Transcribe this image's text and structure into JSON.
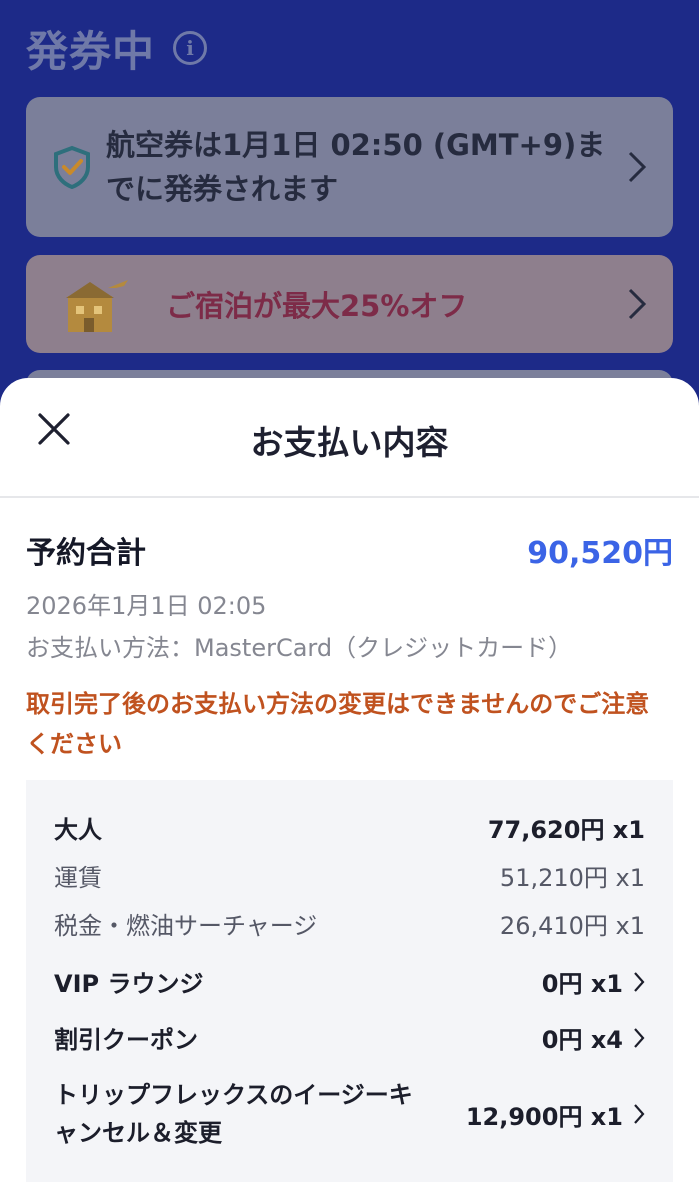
{
  "background": {
    "title": "発券中",
    "ticket_notice": "航空券は1月1日 02:50 (GMT+9)までに発券されます",
    "hotel_offer": "ご宿泊が最大25%オフ"
  },
  "sheet": {
    "title": "お支払い内容",
    "total_label": "予約合計",
    "total_amount": "90,520円",
    "date": "2026年1月1日 02:05",
    "payment_method": "お支払い方法：MasterCard（クレジットカード）",
    "warning": "取引完了後のお支払い方法の変更はできませんのでご注意ください",
    "breakdown": [
      {
        "label": "大人",
        "value": "77,620円 x1"
      },
      {
        "label": "運賃",
        "value": "51,210円 x1"
      },
      {
        "label": "税金・燃油サーチャージ",
        "value": "26,410円 x1"
      },
      {
        "label": "VIP ラウンジ",
        "value": "0円 x1"
      },
      {
        "label": "割引クーポン",
        "value": "0円 x4"
      },
      {
        "label": "トリップフレックスのイージーキャンセル＆変更",
        "value": "12,900円 x1"
      }
    ]
  },
  "icons": [
    "info-icon",
    "shield-check-icon",
    "hotel-plane-icon",
    "chevron-right-icon",
    "close-icon"
  ],
  "colors": {
    "accent_blue": "#3b64e6",
    "warning_orange": "#c0521f",
    "backdrop_navy": "#1d2a88"
  }
}
